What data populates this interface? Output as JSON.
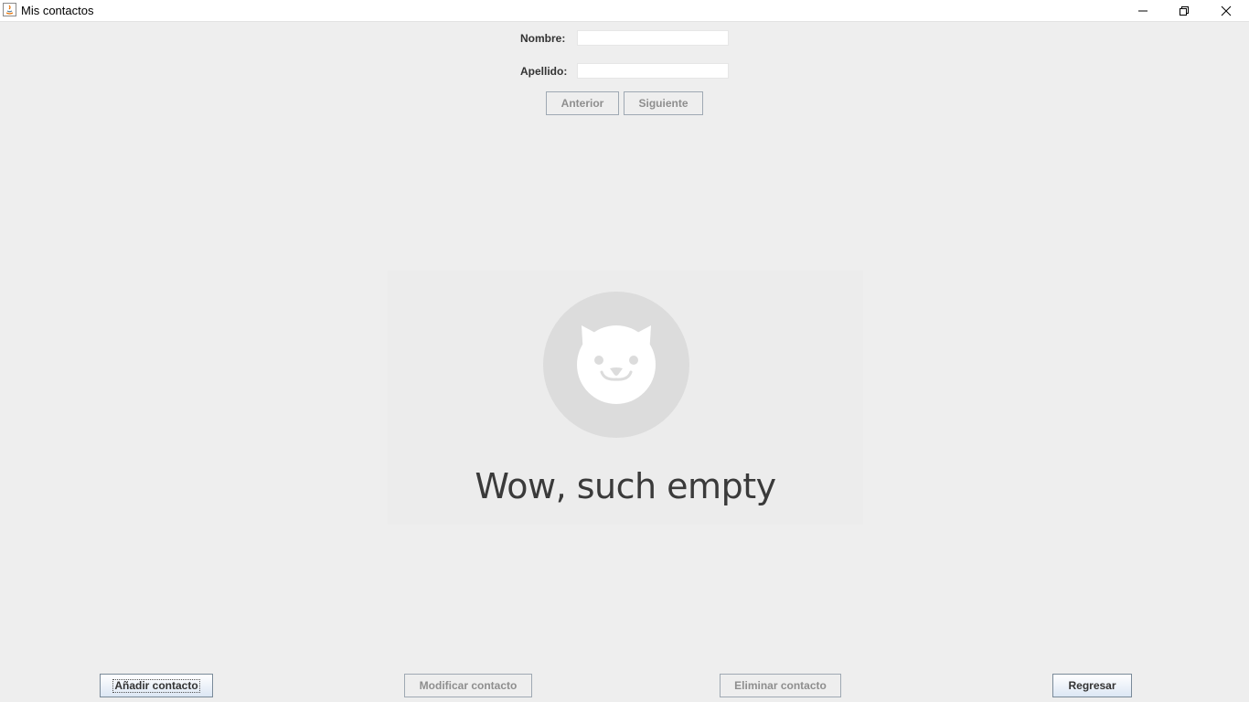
{
  "window": {
    "title": "Mis contactos"
  },
  "form": {
    "nombre_label": "Nombre:",
    "nombre_value": "",
    "apellido_label": "Apellido:",
    "apellido_value": "",
    "prev_label": "Anterior",
    "next_label": "Siguiente"
  },
  "empty_state": {
    "icon": "cat-face-icon",
    "message": "Wow, such empty"
  },
  "actions": {
    "add_label": "Añadir contacto",
    "edit_label": "Modificar contacto",
    "delete_label": "Eliminar contacto",
    "back_label": "Regresar"
  },
  "colors": {
    "background": "#eeeeee",
    "disabled_text": "#8e8e8e",
    "enabled_text": "#333333"
  }
}
